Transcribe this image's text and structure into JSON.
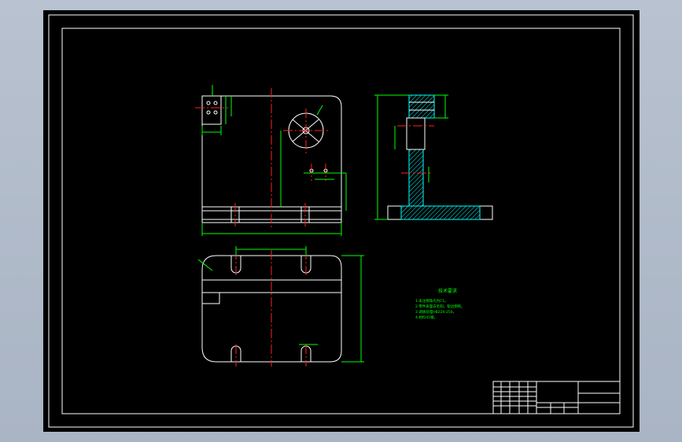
{
  "viewport": {
    "background": "#000000"
  },
  "colors": {
    "frame": "#ffffff",
    "center": "#ff2020",
    "dim": "#00ff00",
    "hatch": "#00ffff",
    "part": "#ffffff"
  },
  "notes": {
    "title": "技术要求",
    "lines": [
      "1.未注倒角均为C1。",
      "2.零件表面去毛刺，锐边倒钝。",
      "3.调质处理HB220-250。",
      "4.材料45钢。"
    ]
  },
  "title_block": {
    "rows": 4,
    "cols": 4
  }
}
